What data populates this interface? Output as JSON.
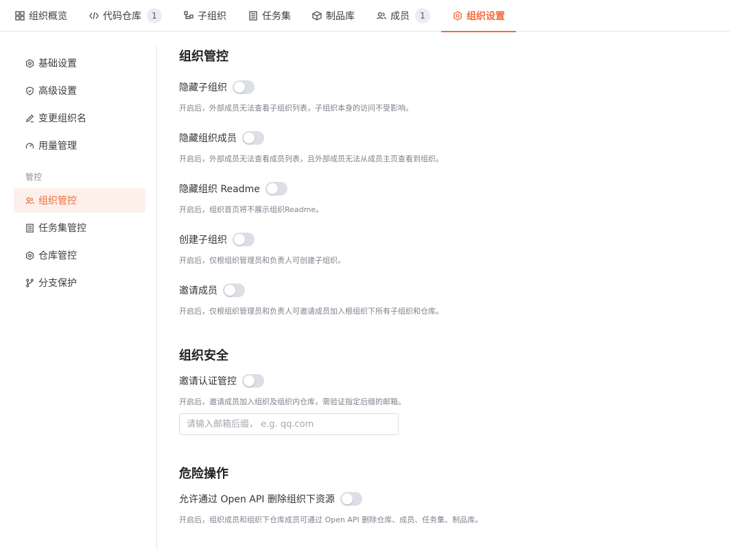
{
  "tabs": [
    {
      "label": "组织概览",
      "icon": "grid-icon",
      "active": false
    },
    {
      "label": "代码仓库",
      "icon": "code-icon",
      "badge": "1",
      "active": false
    },
    {
      "label": "子组织",
      "icon": "sub-org-icon",
      "active": false
    },
    {
      "label": "任务集",
      "icon": "task-list-icon",
      "active": false
    },
    {
      "label": "制品库",
      "icon": "package-icon",
      "active": false
    },
    {
      "label": "成员",
      "icon": "members-icon",
      "badge": "1",
      "active": false
    },
    {
      "label": "组织设置",
      "icon": "settings-icon",
      "active": true
    }
  ],
  "sidebar": {
    "items": [
      {
        "label": "基础设置",
        "icon": "settings-icon"
      },
      {
        "label": "高级设置",
        "icon": "shield-icon"
      },
      {
        "label": "变更组织名",
        "icon": "edit-icon"
      },
      {
        "label": "用量管理",
        "icon": "gauge-icon"
      }
    ],
    "group_label": "管控",
    "group_items": [
      {
        "label": "组织管控",
        "icon": "members-icon",
        "active": true
      },
      {
        "label": "任务集管控",
        "icon": "task-list-icon"
      },
      {
        "label": "仓库管控",
        "icon": "settings-icon"
      },
      {
        "label": "分支保护",
        "icon": "branch-icon"
      }
    ]
  },
  "main": {
    "org_control": {
      "title": "组织管控",
      "settings": [
        {
          "label": "隐藏子组织",
          "enabled": false,
          "desc": "开启后，外部成员无法查看子组织列表，子组织本身的访问不受影响。"
        },
        {
          "label": "隐藏组织成员",
          "enabled": false,
          "desc": "开启后，外部成员无法查看成员列表，且外部成员无法从成员主页查看到组织。"
        },
        {
          "label": "隐藏组织 Readme",
          "enabled": false,
          "desc": "开启后，组织首页将不展示组织Readme。"
        },
        {
          "label": "创建子组织",
          "enabled": false,
          "desc": "开启后，仅根组织管理员和负责人可创建子组织。"
        },
        {
          "label": "邀请成员",
          "enabled": false,
          "desc": "开启后，仅根组织管理员和负责人可邀请成员加入根组织下所有子组织和仓库。"
        }
      ]
    },
    "org_security": {
      "title": "组织安全",
      "setting": {
        "label": "邀请认证管控",
        "enabled": false,
        "desc": "开启后，邀请成员加入组织及组织内仓库，需验证指定后缀的邮箱。"
      },
      "email_suffix": {
        "value": "",
        "placeholder": "请输入邮箱后缀， e.g. qq.com"
      }
    },
    "danger": {
      "title": "危险操作",
      "setting": {
        "label": "允许通过 Open API 删除组织下资源",
        "enabled": false,
        "desc": "开启后，组织成员和组织下仓库成员可通过 Open API 删除仓库、成员、任务集、制品库。"
      }
    }
  },
  "colors": {
    "accent": "#f26b3a",
    "active_bg": "#fdf0ea",
    "toggle_off": "#dcdfe6",
    "badge_bg": "#e9edf3"
  }
}
